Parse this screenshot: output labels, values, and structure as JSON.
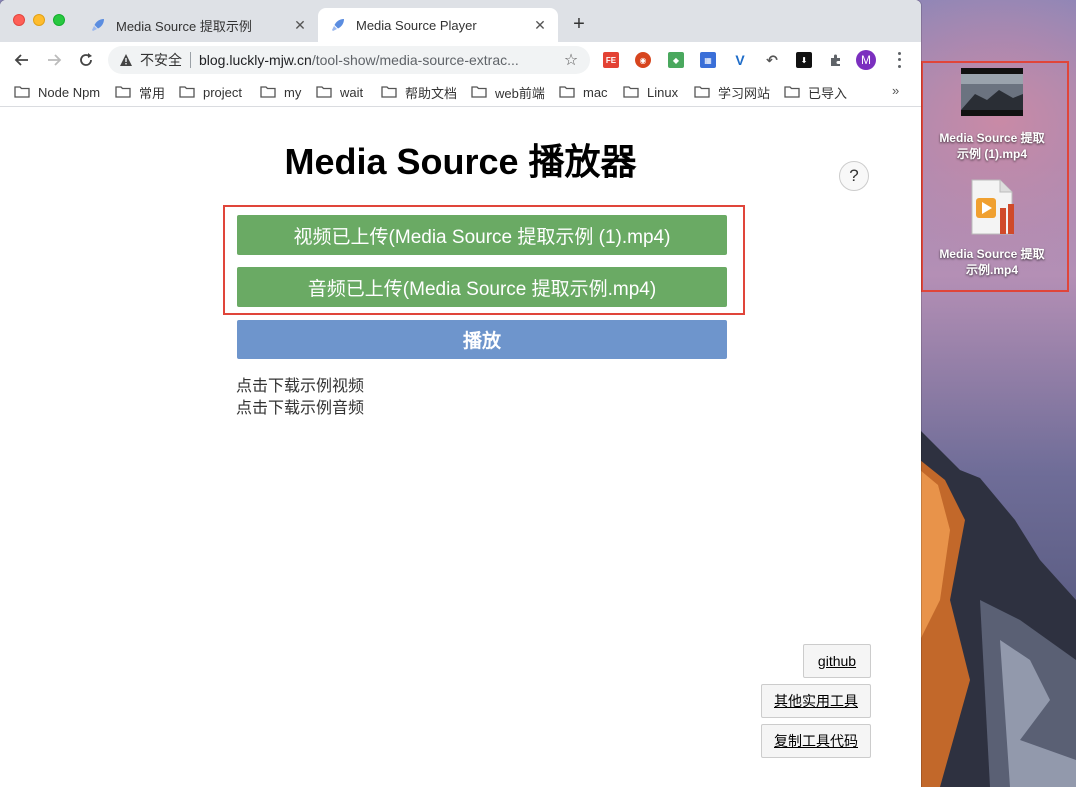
{
  "tabs": [
    {
      "title": "Media Source 提取示例",
      "active": false
    },
    {
      "title": "Media Source Player",
      "active": true
    }
  ],
  "address": {
    "security_label": "不安全",
    "host": "blog.luckly-mjw.cn",
    "path": "/tool-show/media-source-extrac..."
  },
  "extensions": [
    {
      "name": "FE",
      "color": "#e34234"
    },
    {
      "name": "shield",
      "color": "#d7451e"
    },
    {
      "name": "puzzle",
      "color": "#4aa85e"
    },
    {
      "name": "qr",
      "color": "#3a6fd8"
    },
    {
      "name": "V",
      "color": "#1e6cc8"
    }
  ],
  "profile_initial": "M",
  "bookmarks": [
    "Node Npm",
    "常用",
    "project",
    "my",
    "wait",
    "帮助文档",
    "web前端",
    "mac",
    "Linux",
    "学习网站",
    "已导入"
  ],
  "page": {
    "title": "Media Source 播放器",
    "help_label": "?",
    "video_uploaded": "视频已上传(Media Source 提取示例 (1).mp4)",
    "audio_uploaded": "音频已上传(Media Source 提取示例.mp4)",
    "play_label": "播放",
    "download_video": "点击下载示例视频",
    "download_audio": "点击下载示例音频",
    "github_label": "github",
    "other_tools_label": "其他实用工具",
    "copy_code_label": "复制工具代码"
  },
  "desktop_files": [
    {
      "name_line1": "Media Source 提取",
      "name_line2": "示例 (1).mp4"
    },
    {
      "name_line1": "Media Source 提取",
      "name_line2": "示例.mp4"
    }
  ],
  "colors": {
    "upload_button": "#6aaa64",
    "play_button": "#6e95cc",
    "highlight_border": "#e0453a"
  }
}
